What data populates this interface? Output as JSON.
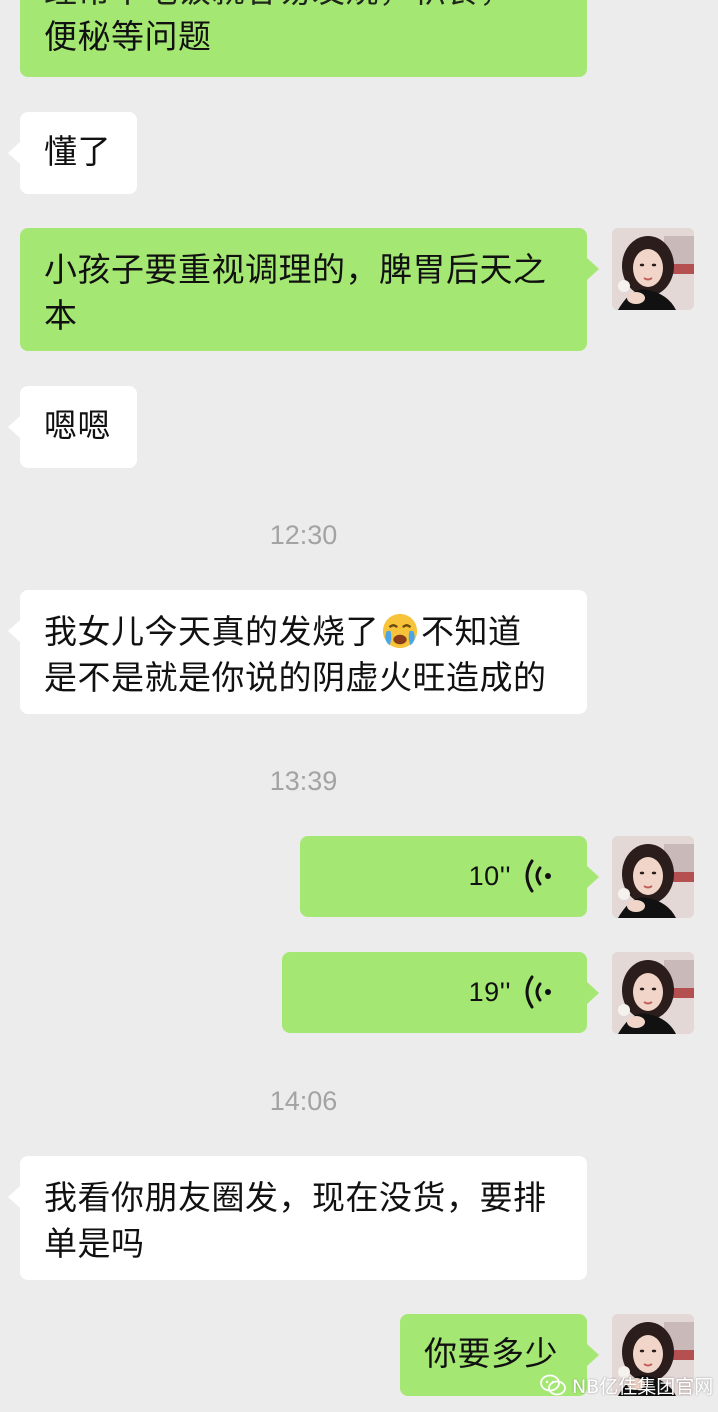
{
  "messages": {
    "m1": {
      "line1": "经常不吃饭就容易发烧，积食，",
      "line2": "便秘等问题"
    },
    "m2": {
      "text": "懂了"
    },
    "m3": {
      "line1": "小孩子要重视调理的，脾胃后天之",
      "line2": "本"
    },
    "m4": {
      "text": "嗯嗯"
    },
    "t1": "12:30",
    "m5": {
      "line1_a": "我女儿今天真的发烧了",
      "emoji": "crying-face-emoji",
      "line1_b": "不知道",
      "line2": "是不是就是你说的阴虚火旺造成的"
    },
    "t2": "13:39",
    "v1": {
      "duration": "10''"
    },
    "v2": {
      "duration": "19''"
    },
    "t3": "14:06",
    "m6": {
      "line1": "我看你朋友圈发，现在没货，要排",
      "line2": "单是吗"
    },
    "m7": {
      "text": "你要多少"
    }
  },
  "watermark": {
    "text": "NB亿佳集团官网",
    "icon": "wechat-official-account-icon"
  },
  "colors": {
    "background": "#ececec",
    "sent_bubble": "#a4e873",
    "received_bubble": "#ffffff",
    "timestamp": "#a3a3a3"
  }
}
